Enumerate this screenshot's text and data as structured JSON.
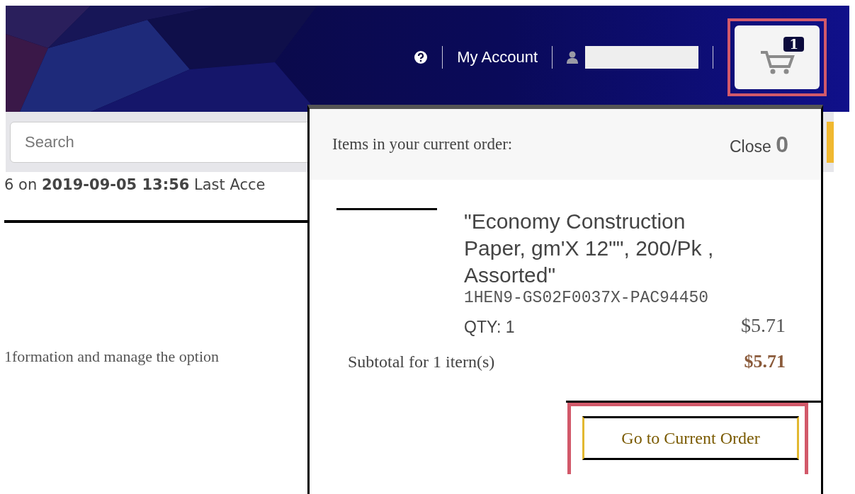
{
  "header": {
    "account_link": "My Account",
    "cart_count": "1"
  },
  "search": {
    "placeholder": "Search"
  },
  "status_line": "6 on **2019-09-05 13:56** Last Acce",
  "description": "1formation and manage the option",
  "cart_popup": {
    "title": "Items in your current order:",
    "close": "Close",
    "close_count": "0",
    "items": [
      {
        "name": "\"Economy Construction Paper, gm'X 12\"\", 200/Pk , Assorted\"",
        "sku": "1HEN9-GS02F0037X-PAC94450",
        "qty": "QTY: 1",
        "price": "$5.71"
      }
    ],
    "subtotal_label": "Subtotal for 1 itern(s)",
    "subtotal": "$5.71",
    "button": "Go to Current Order"
  }
}
